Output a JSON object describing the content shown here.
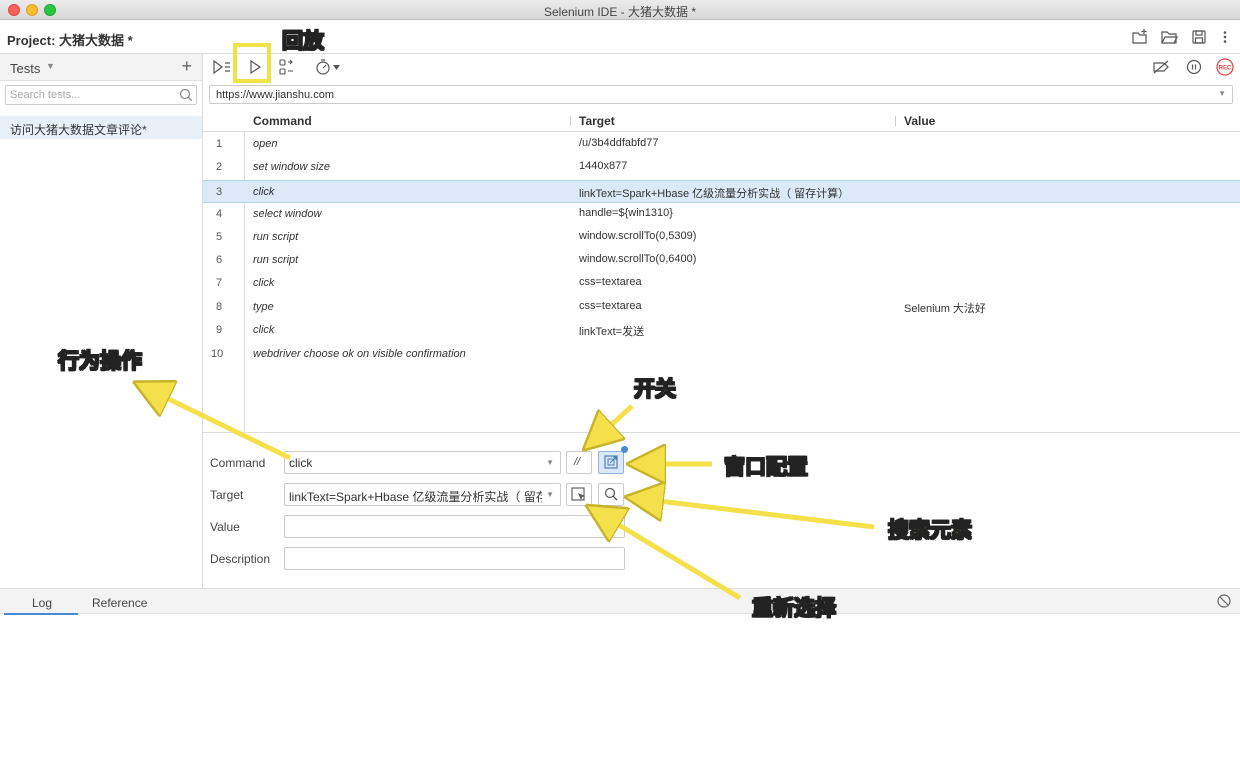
{
  "window": {
    "title": "Selenium IDE - 大猪大数据 *"
  },
  "project": {
    "label": "Project:",
    "name": "大猪大数据 *"
  },
  "sidebar": {
    "header": "Tests",
    "search_placeholder": "Search tests...",
    "tests": [
      "访问大猪大数据文章评论*"
    ]
  },
  "url": "https://www.jianshu.com",
  "table": {
    "headers": {
      "command": "Command",
      "target": "Target",
      "value": "Value"
    },
    "rows": [
      {
        "num": "1",
        "command": "open",
        "target": "/u/3b4ddfabfd77",
        "value": ""
      },
      {
        "num": "2",
        "command": "set window size",
        "target": "1440x877",
        "value": ""
      },
      {
        "num": "3",
        "command": "click",
        "target": "linkText=Spark+Hbase 亿级流量分析实战（ 留存计算）",
        "value": ""
      },
      {
        "num": "4",
        "command": "select window",
        "target": "handle=${win1310}",
        "value": ""
      },
      {
        "num": "5",
        "command": "run script",
        "target": "window.scrollTo(0,5309)",
        "value": ""
      },
      {
        "num": "6",
        "command": "run script",
        "target": "window.scrollTo(0,6400)",
        "value": ""
      },
      {
        "num": "7",
        "command": "click",
        "target": "css=textarea",
        "value": ""
      },
      {
        "num": "8",
        "command": "type",
        "target": "css=textarea",
        "value": "Selenium 大法好"
      },
      {
        "num": "9",
        "command": "click",
        "target": "linkText=发送",
        "value": ""
      },
      {
        "num": "10",
        "command": "webdriver choose ok on visible confirmation",
        "target": "",
        "value": ""
      }
    ],
    "selected_index": 2
  },
  "editor": {
    "command_label": "Command",
    "command_value": "click",
    "target_label": "Target",
    "target_value": "linkText=Spark+Hbase 亿级流量分析实战（ 留存计",
    "value_label": "Value",
    "value_value": "",
    "description_label": "Description",
    "description_value": "",
    "toggle_label": "//"
  },
  "bottom_tabs": [
    "Log",
    "Reference"
  ],
  "annotations": {
    "playback": "回放",
    "action": "行为操作",
    "toggle": "开关",
    "window_config": "窗口配置",
    "search_element": "搜索元素",
    "reselect": "重新选择"
  },
  "colors": {
    "highlight": "#f2e24a",
    "selected_row": "#dce9f8",
    "record_red": "#e64545"
  }
}
